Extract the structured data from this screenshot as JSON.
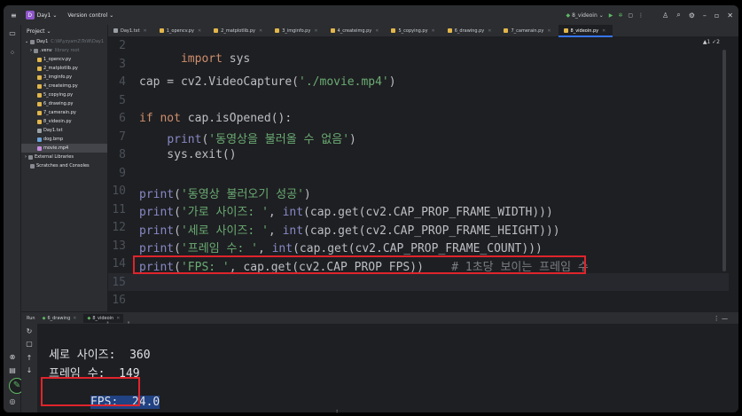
{
  "titlebar": {
    "project_badge": "D",
    "project_name": "Day1",
    "vcs": "Version control",
    "run_config": "8_videoin",
    "menu_icon": "hamburger-menu-icon"
  },
  "project_panel": {
    "title": "Project",
    "root": "Day1",
    "root_path": "C:\\W\\yzyam2\\ToW\\Day1",
    "venv": ".venv",
    "venv_note": "library root",
    "files": [
      {
        "name": "1_opencv.py",
        "type": "py"
      },
      {
        "name": "2_matplotlib.py",
        "type": "py"
      },
      {
        "name": "3_imginfo.py",
        "type": "py"
      },
      {
        "name": "4_createimg.py",
        "type": "py"
      },
      {
        "name": "5_copying.py",
        "type": "py"
      },
      {
        "name": "6_drawing.py",
        "type": "py"
      },
      {
        "name": "7_camerain.py",
        "type": "py"
      },
      {
        "name": "8_videoin.py",
        "type": "py"
      },
      {
        "name": "Day1.txt",
        "type": "txt"
      },
      {
        "name": "dog.bmp",
        "type": "img"
      },
      {
        "name": "movie.mp4",
        "type": "mp4"
      }
    ],
    "external": "External Libraries",
    "scratches": "Scratches and Consoles"
  },
  "tabs": [
    {
      "label": "Day1.txt",
      "type": "txt"
    },
    {
      "label": "1_opencv.py",
      "type": "py"
    },
    {
      "label": "2_matplotlib.py",
      "type": "py"
    },
    {
      "label": "3_imginfo.py",
      "type": "py"
    },
    {
      "label": "4_createimg.py",
      "type": "py"
    },
    {
      "label": "5_copying.py",
      "type": "py"
    },
    {
      "label": "6_drawing.py",
      "type": "py"
    },
    {
      "label": "7_camerain.py",
      "type": "py"
    },
    {
      "label": "8_videoin.py",
      "type": "py",
      "active": true
    }
  ],
  "editor": {
    "status": "▲1 ✓2",
    "line_numbers": [
      "2",
      "3",
      "4",
      "5",
      "6",
      "7",
      "8",
      "9",
      "10",
      "11",
      "12",
      "13",
      "14",
      "15",
      "16"
    ],
    "line_2": "import sys",
    "line_4": "cap = cv2.VideoCapture('./movie.mp4')",
    "line_6": "if not cap.isOpened():",
    "line_7": "    print('동영상을 불러올 수 없음')",
    "line_8": "    sys.exit()",
    "line_10": "print('동영상 불러오기 성공')",
    "line_11": "print('가로 사이즈: ', int(cap.get(cv2.CAP_PROP_FRAME_WIDTH)))",
    "line_12": "print('세로 사이즈: ', int(cap.get(cv2.CAP_PROP_FRAME_HEIGHT)))",
    "line_13": "print('프레임 수: ', int(cap.get(cv2.CAP_PROP_FRAME_COUNT)))",
    "line_14": "print('FPS: ', cap.get(cv2.CAP_PROP_FPS))    # 1초당 보이는 프레임 수"
  },
  "run_panel": {
    "title": "Run",
    "tabs": [
      "6_drawing",
      "8_videoin"
    ],
    "output": [
      "세로 사이즈:  360",
      "프레임 수:  149",
      "FPS:  24.0"
    ]
  },
  "colors": {
    "accent": "#3574f0",
    "highlight_box": "#e0242c",
    "selection": "#214283"
  }
}
